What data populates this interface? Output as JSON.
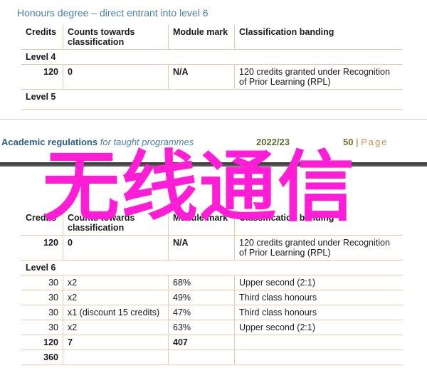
{
  "top": {
    "title": "Honours degree – direct entrant into level 6",
    "headers": [
      "Credits",
      "Counts towards classification",
      "Module mark",
      "Classification banding"
    ],
    "level4_label": "Level 4",
    "row": {
      "credits": "120",
      "counts": "0",
      "mark": "N/A",
      "banding": "120 credits granted under Recognition of Prior Learning (RPL)"
    },
    "level5_label": "Level 5"
  },
  "footer": {
    "doc_bold": "Academic regulations",
    "doc_italic": "for taught programmes",
    "year": "2022/23",
    "page_number": "50",
    "separator": "|",
    "page_label": "Page"
  },
  "bottom": {
    "headers": [
      "Credits",
      "Counts towards classification",
      "Module mark",
      "Classification banding"
    ],
    "first_row": {
      "credits": "120",
      "counts": "0",
      "mark": "N/A",
      "banding": "120 credits granted under Recognition of Prior Learning (RPL)"
    },
    "level6_label": "Level 6",
    "rows": [
      {
        "credits": "30",
        "counts": "x2",
        "mark": "68%",
        "banding": "Upper second (2:1)"
      },
      {
        "credits": "30",
        "counts": "x2",
        "mark": "49%",
        "banding": "Third class honours"
      },
      {
        "credits": "30",
        "counts": "x1 (discount 15 credits)",
        "mark": "47%",
        "banding": "Third class honours"
      },
      {
        "credits": "30",
        "counts": "x2",
        "mark": "63%",
        "banding": "Upper second (2:1)"
      }
    ],
    "total_row": {
      "credits": "120",
      "counts": "7",
      "mark": "407"
    },
    "grand_total": "360"
  },
  "watermark": "无线通信"
}
